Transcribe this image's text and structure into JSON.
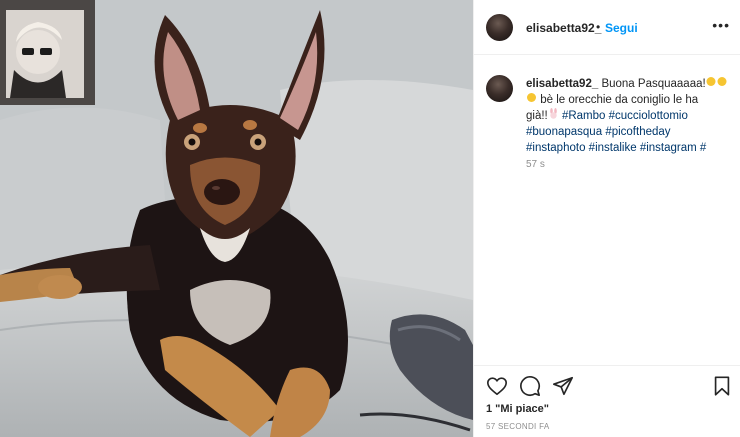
{
  "post": {
    "username": "elisabetta92_",
    "dot": "•",
    "follow_label": "Segui",
    "more_label": "•••",
    "caption": {
      "username": "elisabetta92_",
      "line1": "Buona Pasquaaaaa!",
      "line2": "bè le orecchie da coniglio le ha",
      "line3": "già!!",
      "tags": [
        "#Rambo",
        "#cucciolottomio",
        "#buonapasqua",
        "#picoftheday",
        "#instaphoto",
        "#instalike",
        "#instagram",
        "#"
      ]
    },
    "relative_time": "57 s",
    "likes": "1 \"Mi piace\"",
    "posted_ago": "57 SECONDI FA"
  },
  "icons": {
    "like": "heart-icon",
    "comment": "comment-icon",
    "share": "share-icon",
    "save": "bookmark-icon"
  },
  "colors": {
    "link": "#0095f6",
    "hashtag": "#00376b",
    "muted": "#8e8e8e",
    "text": "#262626"
  }
}
